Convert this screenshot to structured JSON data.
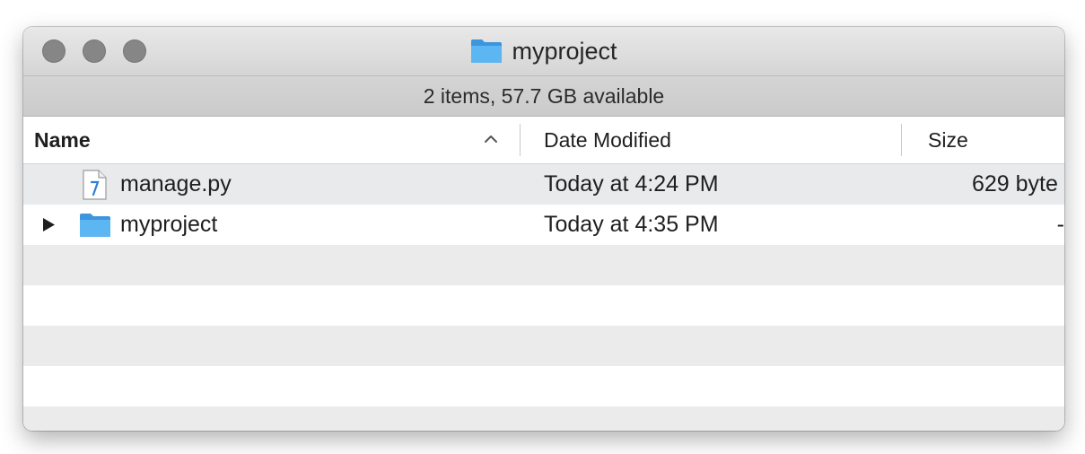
{
  "window": {
    "title": "myproject",
    "status": "2 items, 57.7 GB available"
  },
  "columns": {
    "name": "Name",
    "date": "Date Modified",
    "size": "Size",
    "sort_icon": "chevron-up-icon"
  },
  "files": [
    {
      "name": "manage.py",
      "date": "Today at 4:24 PM",
      "size": "629 byte",
      "icon": "python-file-icon"
    },
    {
      "name": "myproject",
      "date": "Today at 4:35 PM",
      "size": "-",
      "icon": "folder-icon"
    }
  ],
  "colors": {
    "folder": "#4aa3e8",
    "window_controls": "#868686"
  }
}
